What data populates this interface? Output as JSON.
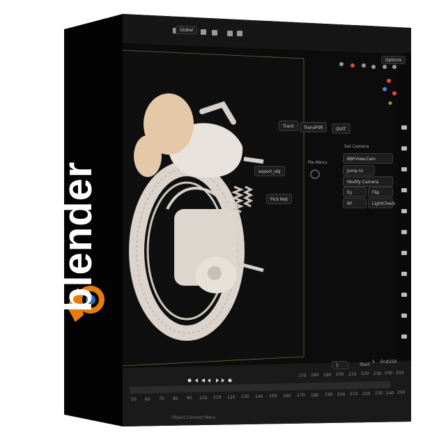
{
  "brand": {
    "wordmark": "blender",
    "logo": "blender-logo"
  },
  "header": {
    "orientation_label": "Global",
    "options_label": "Options"
  },
  "pie_menu": {
    "title": "Pie Menu",
    "track_label": "Track",
    "transform_label": "TransPSR",
    "quit_label": "QUIT",
    "export_label": "export_obj",
    "pick_label": "Pick Mat"
  },
  "camera_panel": {
    "title": "Set Camera",
    "items": [
      "BBFView.Cam",
      "Jump to",
      "Modify Camera",
      "Ey",
      "Flip",
      "RF",
      "LightCheck"
    ]
  },
  "timeline": {
    "current_frame": "1",
    "start_label": "Start",
    "start_value": "1",
    "end_label": "End",
    "end_value": "250",
    "ruler_upper": [
      "170",
      "180",
      "190",
      "200",
      "210",
      "220",
      "230",
      "240",
      "250"
    ],
    "ruler_lower": [
      "50",
      "60",
      "70",
      "80",
      "90",
      "100",
      "110",
      "120",
      "130",
      "140",
      "150",
      "160",
      "170",
      "180",
      "190",
      "200",
      "210",
      "220",
      "230",
      "240",
      "250"
    ]
  },
  "status": {
    "context_menu": "Object Context Menu"
  },
  "colors": {
    "box": "#050505",
    "viewport": "#111111",
    "accent": "#e87d0d",
    "logo_blue": "#2f6fb5"
  }
}
